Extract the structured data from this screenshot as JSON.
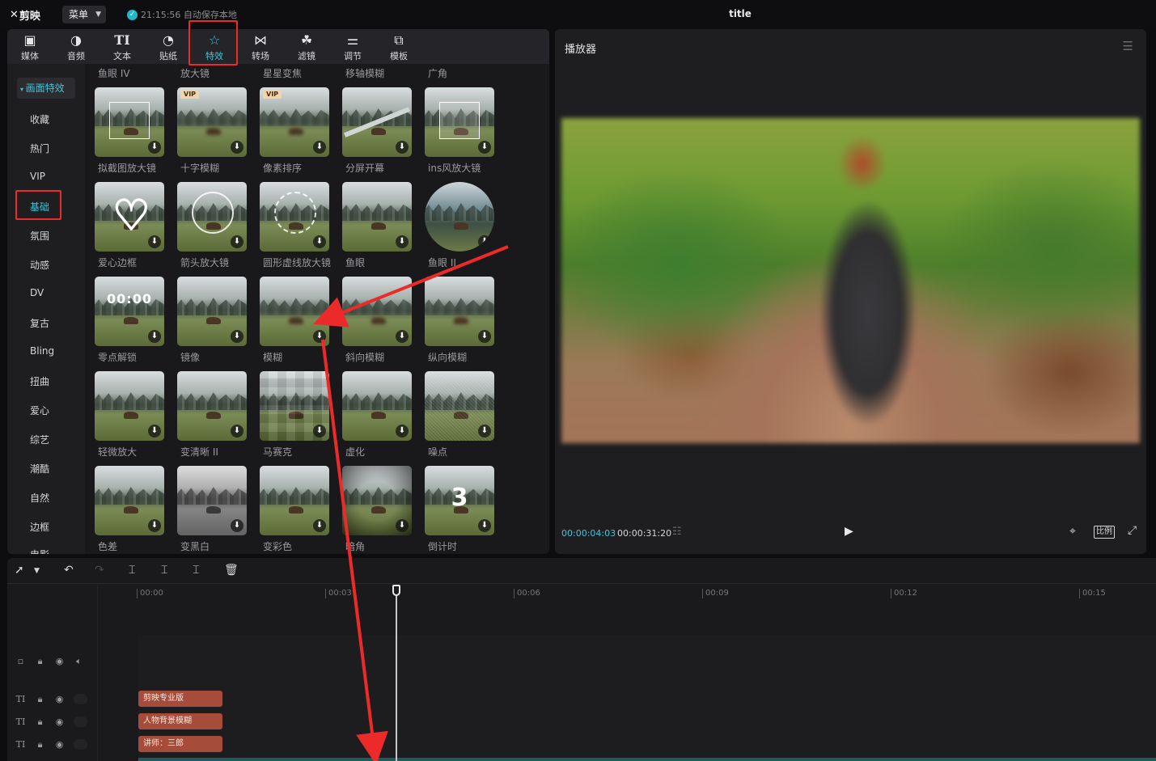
{
  "app": {
    "logo_text": "剪映",
    "menu_label": "菜单",
    "save_status": "21:15:56 自动保存本地",
    "window_title": "title"
  },
  "toolbar": {
    "items": [
      {
        "label": "媒体",
        "icon": "media-icon",
        "glyph": "▶"
      },
      {
        "label": "音频",
        "icon": "audio-icon",
        "glyph": "♪"
      },
      {
        "label": "文本",
        "icon": "text-icon",
        "glyph": "TI"
      },
      {
        "label": "贴纸",
        "icon": "sticker-icon",
        "glyph": "◔"
      },
      {
        "label": "特效",
        "icon": "effects-icon",
        "glyph": "☆"
      },
      {
        "label": "转场",
        "icon": "transition-icon",
        "glyph": "⋈"
      },
      {
        "label": "滤镜",
        "icon": "filter-icon",
        "glyph": "☘"
      },
      {
        "label": "调节",
        "icon": "adjust-icon",
        "glyph": "⚌"
      },
      {
        "label": "模板",
        "icon": "template-icon",
        "glyph": "⧉"
      }
    ],
    "active": "特效"
  },
  "categories": {
    "header": "画面特效",
    "items": [
      "收藏",
      "热门",
      "VIP",
      "基础",
      "氛围",
      "动感",
      "DV",
      "复古",
      "Bling",
      "扭曲",
      "爱心",
      "综艺",
      "潮酷",
      "自然",
      "边框",
      "电影"
    ],
    "selected": "基础"
  },
  "effects": {
    "top_row_labels": [
      "鱼眼 IV",
      "放大镜",
      "星星变焦",
      "移轴模糊",
      "广角"
    ],
    "rows": [
      [
        "拟截图放大镜",
        "十字模糊",
        "像素排序",
        "分屏开幕",
        "ins风放大镜"
      ],
      [
        "爱心边框",
        "箭头放大镜",
        "圆形虚线放大镜",
        "鱼眼",
        "鱼眼 II"
      ],
      [
        "零点解锁",
        "镜像",
        "模糊",
        "斜向模糊",
        "纵向模糊"
      ],
      [
        "轻微放大",
        "变清晰 II",
        "马赛克",
        "虚化",
        "噪点"
      ],
      [
        "色差",
        "变黑白",
        "变彩色",
        "暗角",
        "倒计时"
      ]
    ],
    "vip_badge": "VIP",
    "clock_text": "00:00",
    "countdown_text": "3"
  },
  "player": {
    "title": "播放器",
    "time_current": "00:00:04:03",
    "time_total": "00:00:31:20",
    "ratio_label": "比例"
  },
  "timeline": {
    "ticks": [
      "00:00",
      "00:03",
      "00:06",
      "00:09",
      "00:12",
      "00:15"
    ],
    "text_clips": [
      "剪映专业版",
      "人物背景模糊",
      "讲师：三郎"
    ]
  },
  "colors": {
    "accent": "#3ec6d8",
    "annotation_red": "#ec2a2a",
    "clip": "#a54c3a"
  }
}
